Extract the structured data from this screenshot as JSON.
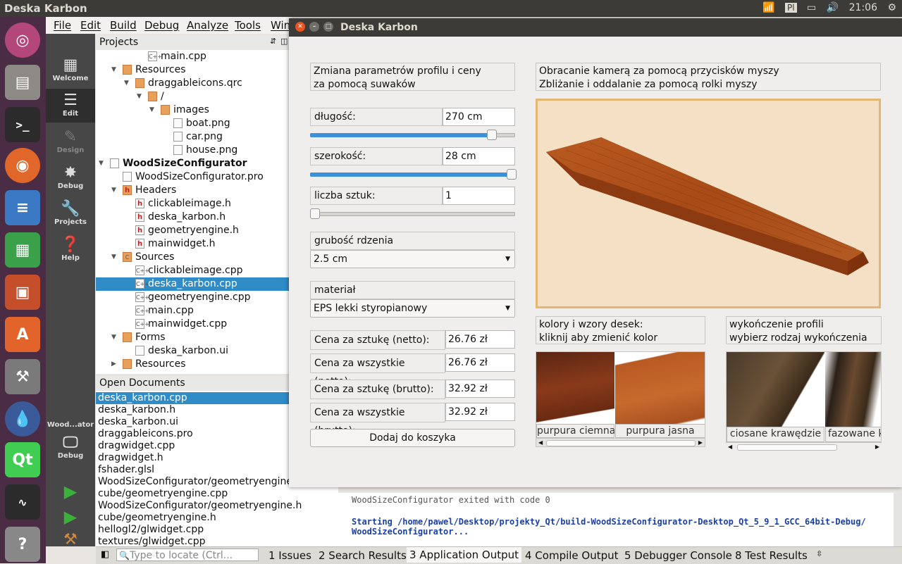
{
  "system": {
    "active_app": "Deska Karbon",
    "keyboard_layout": "Pl",
    "time": "21:06"
  },
  "launcher_icons": [
    "ubuntu-icon",
    "files-icon",
    "terminal-icon",
    "firefox-icon",
    "writer-icon",
    "calc-icon",
    "impress-icon",
    "software-center-icon",
    "settings-icon",
    "drop-icon",
    "qt-creator-icon",
    "system-monitor-icon",
    "help-icon"
  ],
  "menubar": [
    "File",
    "Edit",
    "Build",
    "Debug",
    "Analyze",
    "Tools",
    "Win"
  ],
  "modes": {
    "welcome": "Welcome",
    "edit": "Edit",
    "design": "Design",
    "debug": "Debug",
    "projects": "Projects",
    "help": "Help",
    "target": "Wood...ator",
    "target_mode": "Debug"
  },
  "projects_header": "Projects",
  "tree": [
    {
      "label": "main.cpp",
      "indent": 3,
      "icon": "cpp"
    },
    {
      "label": "Resources",
      "indent": 1,
      "icon": "res",
      "arrow": "down"
    },
    {
      "label": "draggableicons.qrc",
      "indent": 2,
      "icon": "res",
      "arrow": "down"
    },
    {
      "label": "/",
      "indent": 3,
      "icon": "folder",
      "arrow": "down"
    },
    {
      "label": "images",
      "indent": 4,
      "icon": "folder",
      "arrow": "down"
    },
    {
      "label": "boat.png",
      "indent": 5,
      "icon": "file"
    },
    {
      "label": "car.png",
      "indent": 5,
      "icon": "file"
    },
    {
      "label": "house.png",
      "indent": 5,
      "icon": "file"
    },
    {
      "label": "WoodSizeConfigurator",
      "indent": 0,
      "icon": "pro",
      "arrow": "down",
      "bold": true
    },
    {
      "label": "WoodSizeConfigurator.pro",
      "indent": 1,
      "icon": "pro"
    },
    {
      "label": "Headers",
      "indent": 1,
      "icon": "hdr",
      "arrow": "down"
    },
    {
      "label": "clickableimage.h",
      "indent": 2,
      "icon": "h"
    },
    {
      "label": "deska_karbon.h",
      "indent": 2,
      "icon": "h"
    },
    {
      "label": "geometryengine.h",
      "indent": 2,
      "icon": "h"
    },
    {
      "label": "mainwidget.h",
      "indent": 2,
      "icon": "h"
    },
    {
      "label": "Sources",
      "indent": 1,
      "icon": "src",
      "arrow": "down"
    },
    {
      "label": "clickableimage.cpp",
      "indent": 2,
      "icon": "cpp"
    },
    {
      "label": "deska_karbon.cpp",
      "indent": 2,
      "icon": "cpp",
      "selected": true
    },
    {
      "label": "geometryengine.cpp",
      "indent": 2,
      "icon": "cpp"
    },
    {
      "label": "main.cpp",
      "indent": 2,
      "icon": "cpp"
    },
    {
      "label": "mainwidget.cpp",
      "indent": 2,
      "icon": "cpp"
    },
    {
      "label": "Forms",
      "indent": 1,
      "icon": "form",
      "arrow": "down"
    },
    {
      "label": "deska_karbon.ui",
      "indent": 2,
      "icon": "ui"
    },
    {
      "label": "Resources",
      "indent": 1,
      "icon": "res",
      "arrow": "right"
    }
  ],
  "open_documents_header": "Open Documents",
  "open_documents": [
    "deska_karbon.cpp",
    "deska_karbon.h",
    "deska_karbon.ui",
    "draggableicons.pro",
    "dragwidget.cpp",
    "dragwidget.h",
    "fshader.glsl",
    "WoodSizeConfigurator/geometryengine.cpp",
    "cube/geometryengine.cpp",
    "WoodSizeConfigurator/geometryengine.h",
    "cube/geometryengine.h",
    "hellogl2/glwidget.cpp",
    "textures/glwidget.cpp"
  ],
  "output": {
    "exited": "WoodSizeConfigurator exited with code 0",
    "starting": "Starting /home/pawel/Desktop/projekty_Qt/build-WoodSizeConfigurator-Desktop_Qt_5_9_1_GCC_64bit-Debug/",
    "starting2": "WoodSizeConfigurator..."
  },
  "bottom_tabs": {
    "locator_placeholder": "Type to locate (Ctrl...",
    "issues": "1  Issues",
    "search": "2  Search Results",
    "app_output": "3  Application Output",
    "compile": "4  Compile Output",
    "debugger": "5  Debugger Console",
    "tests": "8  Test Results"
  },
  "dialog": {
    "title": "Deska Karbon",
    "intro_line1": "Zmiana parametrów profilu i ceny",
    "intro_line2": "za pomocą suwaków",
    "camera_line1": "Obracanie kamerą za pomocą przycisków myszy",
    "camera_line2": "Zbliżanie i oddalanie za pomocą rolki myszy",
    "length_label": "długość:",
    "length_value": "270 cm",
    "length_slider": 0.9,
    "width_label": "szerokość:",
    "width_value": "28 cm",
    "width_slider": 1.0,
    "count_label": "liczba sztuk:",
    "count_value": "1",
    "count_slider": 0.0,
    "core_label": "grubość rdzenia",
    "core_value": "2.5 cm",
    "material_label": "materiał",
    "material_value": "EPS lekki styropianowy",
    "price_unit_net_label": "Cena za sztukę (netto):",
    "price_unit_net": "26.76 zł",
    "price_all_net_label": "Cena za wszystkie (netto):",
    "price_all_net": "26.76 zł",
    "price_unit_gross_label": "Cena za sztukę (brutto):",
    "price_unit_gross": "32.92 zł",
    "price_all_gross_label": "Cena za wszystkie (brutto):",
    "price_all_gross": "32.92 zł",
    "add_to_cart": "Dodaj do koszyka",
    "colors_line1": "kolory i wzory desek:",
    "colors_line2": "kliknij aby zmienić kolor",
    "color_options": [
      "purpura ciemna",
      "purpura jasna"
    ],
    "finish_line1": "wykończenie profili",
    "finish_line2": "wybierz rodzaj wykończenia",
    "finish_options": [
      "ciosane krawędzie",
      "fazowane k"
    ]
  }
}
